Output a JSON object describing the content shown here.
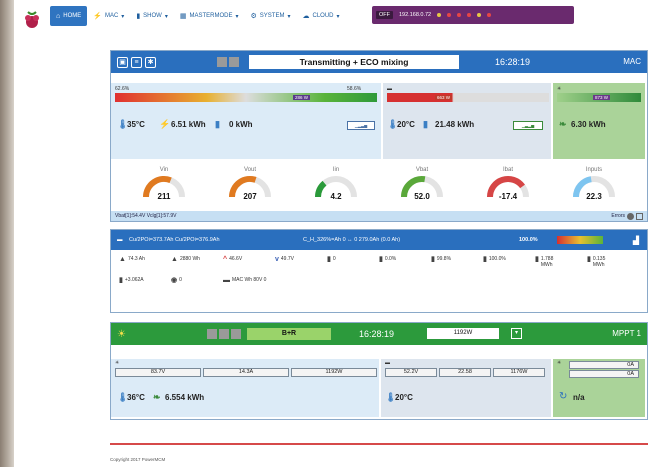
{
  "nav": {
    "items": [
      {
        "label": "HOME",
        "icon": "home-icon",
        "active": true
      },
      {
        "label": "MAC",
        "icon": "plug-icon"
      },
      {
        "label": "SHOW",
        "icon": "bar-chart-icon"
      },
      {
        "label": "MASTERMODE",
        "icon": "grid-icon"
      },
      {
        "label": "SYSTEM",
        "icon": "gear-icon"
      },
      {
        "label": "CLOUD",
        "icon": "cloud-icon"
      }
    ],
    "power_off": "OFF",
    "ip": "192.168.0.72"
  },
  "panel1": {
    "title": "Transmitting + ECO mixing",
    "time": "16:28:19",
    "right": "MAC",
    "grid": {
      "bar_left": "62.6%",
      "bar_right": "58.6%",
      "bar_label": "286 W",
      "temp": "35°C",
      "energy1": "6.51 kWh",
      "energy2": "0 kWh"
    },
    "battery": {
      "bar_label": "663 W",
      "temp": "20°C",
      "energy": "21.48 kWh"
    },
    "pv": {
      "bar_label": "873 W",
      "energy": "6.30 kWh"
    },
    "gauges": [
      {
        "label": "Vin",
        "value": "211",
        "color": "#e07a20",
        "level": 0.62
      },
      {
        "label": "Vout",
        "value": "207",
        "color": "#e07a20",
        "level": 0.6
      },
      {
        "label": "Iin",
        "value": "4.2",
        "color": "#2a9a3a",
        "level": 0.28
      },
      {
        "label": "Vbat",
        "value": "52.0",
        "color": "#5aa83a",
        "level": 0.55
      },
      {
        "label": "Ibat",
        "value": "-17.4",
        "color": "#d64545",
        "level": 0.8
      },
      {
        "label": "Inputs",
        "value": "22.3",
        "color": "#7ec5f0",
        "level": 0.45
      }
    ],
    "footer_left": "Vbat[1]:54.4V   Vclg[1]:57.9V",
    "footer_right": "Errors"
  },
  "panel2": {
    "header_left": "Cu/2POi=373.7Ah   Cu/2POi=376.9Ah",
    "header_mid": "C_H_326%=Ah   0 ↔ 0   279.0Ah (0.0 Ah)",
    "header_right": "100.0%",
    "stats": [
      {
        "icon": "▲",
        "lines": [
          "74.3 Ah"
        ]
      },
      {
        "icon": "▲",
        "lines": [
          "",
          "2880 Wh"
        ]
      },
      {
        "icon": "^",
        "lines": [
          "46.6V"
        ]
      },
      {
        "icon": "v",
        "lines": [
          "49.7V"
        ]
      },
      {
        "icon": "▮",
        "lines": [
          "0"
        ]
      },
      {
        "icon": "▮",
        "lines": [
          "0.0%"
        ]
      },
      {
        "icon": "▮",
        "lines": [
          "",
          "99.8%"
        ]
      },
      {
        "icon": "▮",
        "lines": [
          "",
          "100.0%"
        ]
      },
      {
        "icon": "▮",
        "lines": [
          "",
          "1.788",
          "MWh"
        ]
      },
      {
        "icon": "▮",
        "lines": [
          "",
          "0.135",
          "MWh"
        ]
      },
      {
        "icon": "▮",
        "lines": [
          "",
          "+3.062A"
        ]
      },
      {
        "icon": "◉",
        "lines": [
          "0"
        ]
      },
      {
        "icon": "▬",
        "lines": [
          "MAC Wh 80V 0"
        ]
      }
    ]
  },
  "panel3": {
    "mode": "B+R",
    "time": "16:28:19",
    "power": "1192W",
    "right": "MPPT 1",
    "pv": {
      "v": "83.7V",
      "a": "14.3A",
      "w": "1192W",
      "temp": "36°C",
      "energy": "6.554 kWh"
    },
    "batt": {
      "v": "52.2V",
      "a": "22.58",
      "w": "1176W",
      "temp": "20°C"
    },
    "load": {
      "a": "0A",
      "b": "0A",
      "text": "n/a"
    }
  },
  "footer": {
    "copyright": "Copyright 2017 PowerMCM"
  },
  "colors": {
    "accent_blue": "#2a6fbe",
    "accent_green": "#2c9a3c",
    "power_purple": "#6a2a6e"
  }
}
